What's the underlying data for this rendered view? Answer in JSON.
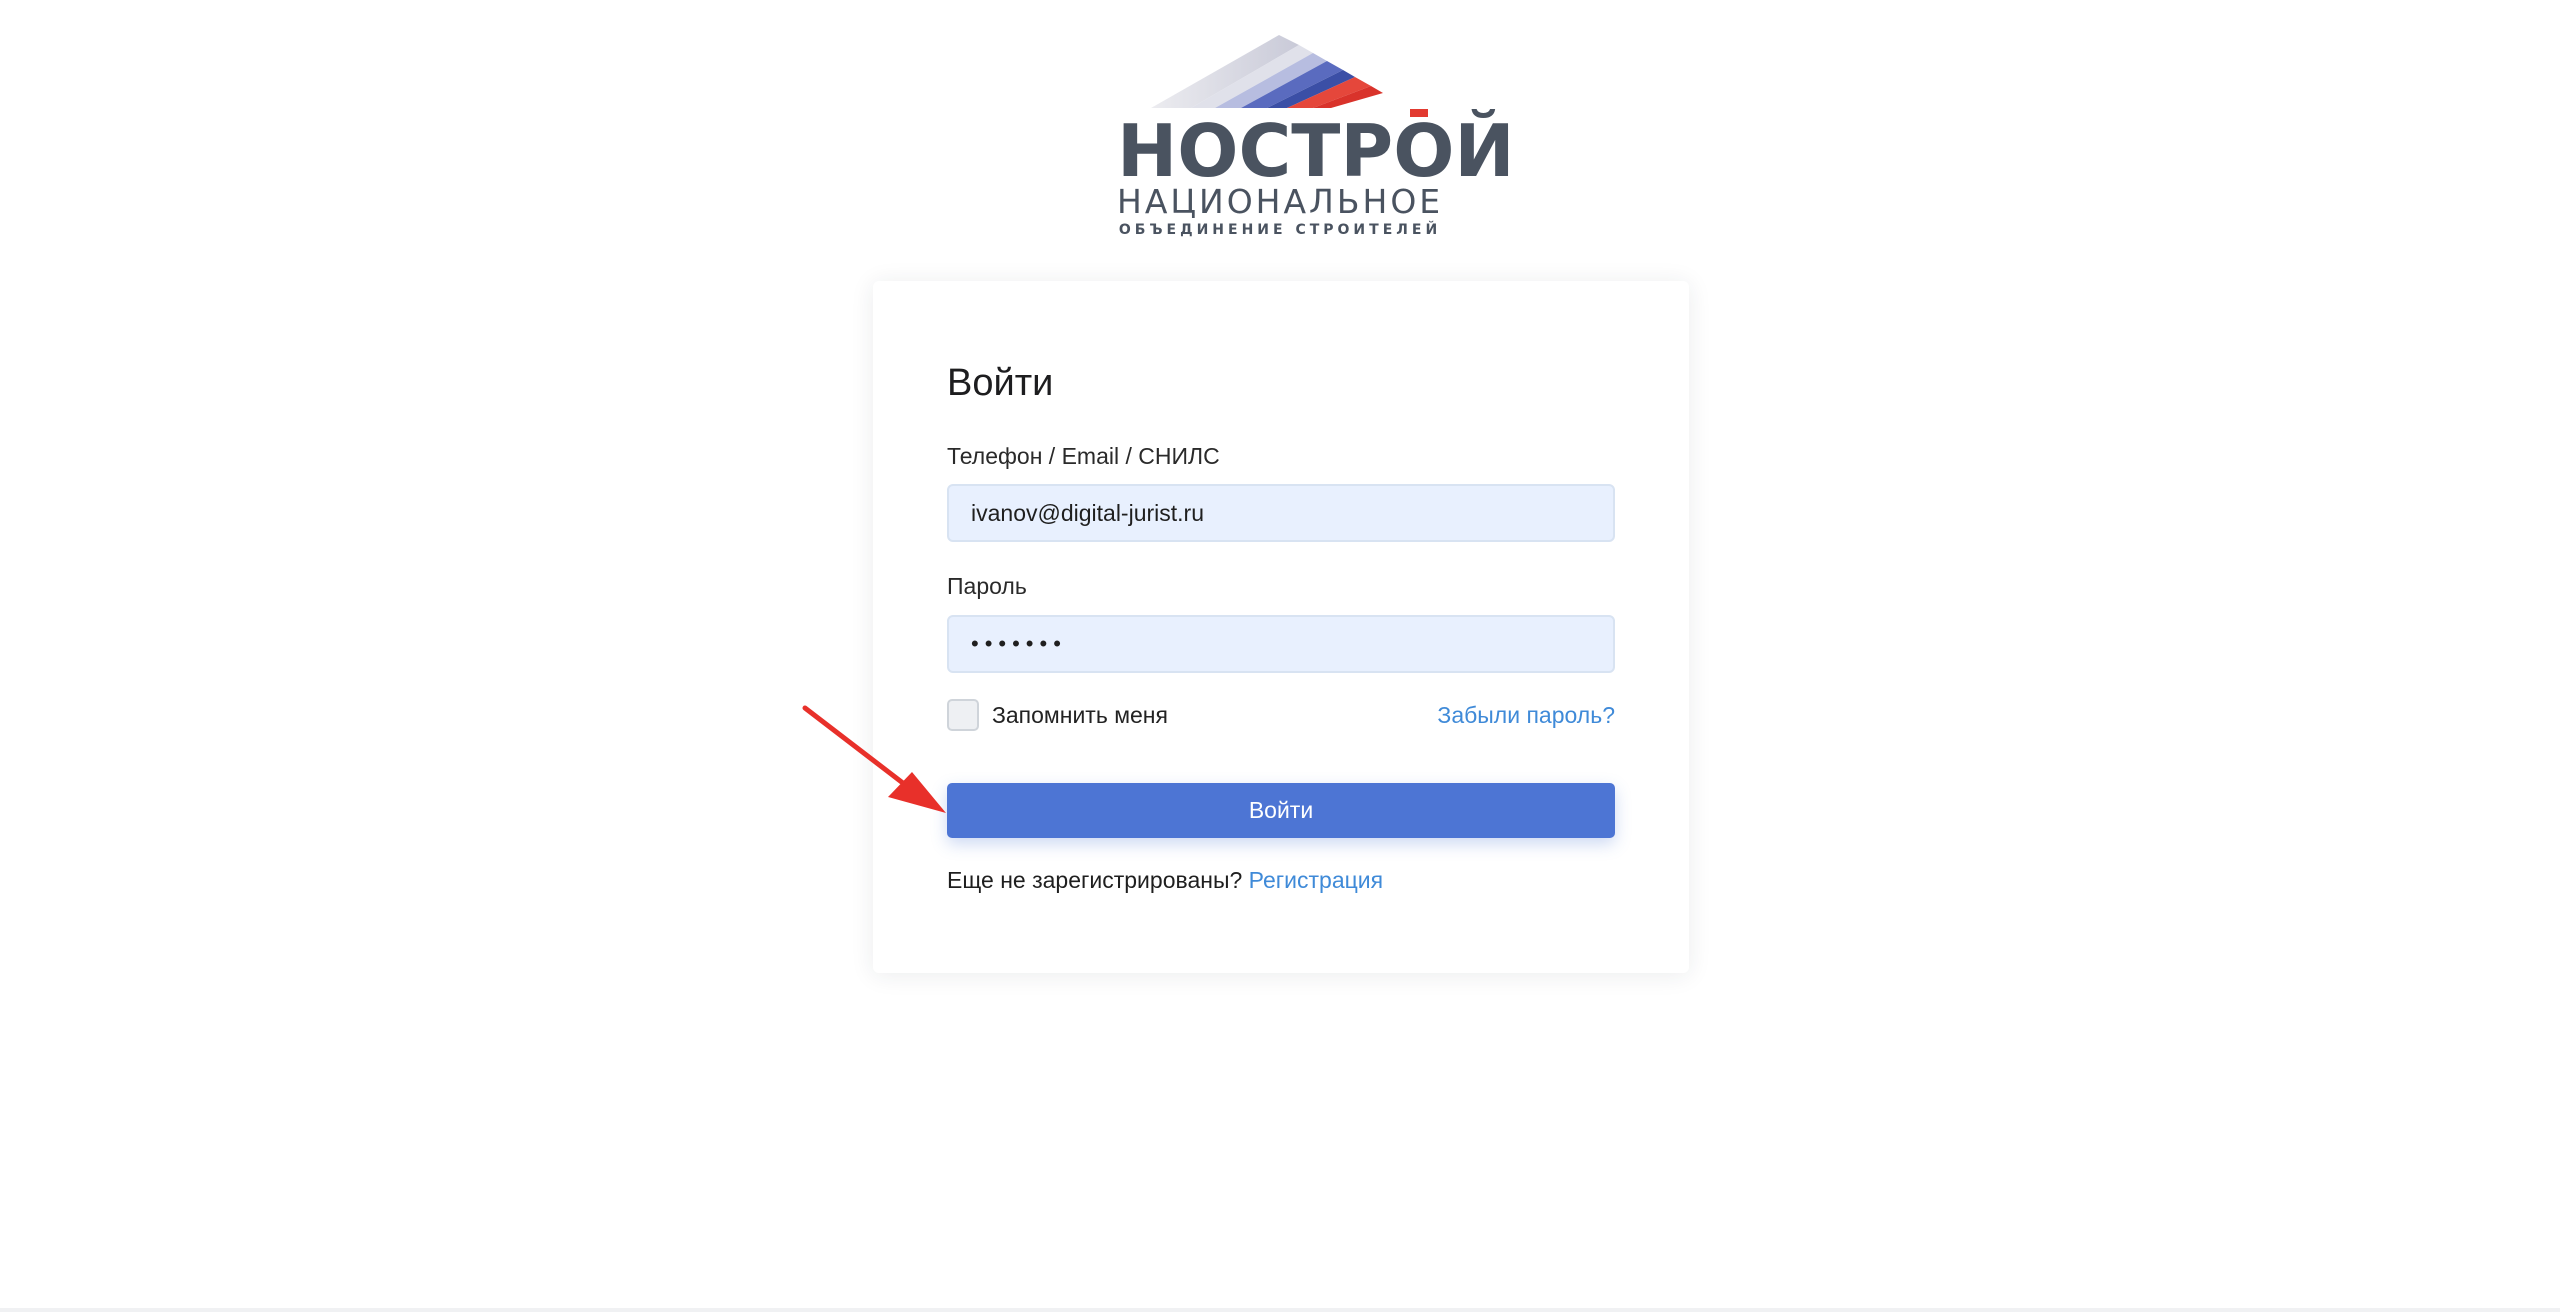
{
  "logo": {
    "wordmark": "НОСТРОЙ",
    "subtitle_line1": "НАЦИОНАЛЬНОЕ",
    "subtitle_line2": "ОБЪЕДИНЕНИЕ СТРОИТЕЛЕЙ",
    "colors": {
      "white": "#e2e2ea",
      "blue": "#4056a8",
      "red": "#e23a30",
      "text": "#4a5360"
    }
  },
  "login_form": {
    "title": "Войти",
    "login_label": "Телефон / Email / СНИЛС",
    "login_value": "ivanov@digital-jurist.ru",
    "password_label": "Пароль",
    "password_value": "•••••••",
    "remember_label": "Запомнить меня",
    "remember_checked": false,
    "forgot_link": "Забыли пароль?",
    "submit_label": "Войти",
    "register_prompt": "Еще не зарегистрированы?",
    "register_link": "Регистрация"
  },
  "annotation": {
    "arrow_color": "#e8302a",
    "arrow_icon": "red-arrow-pointing-to-submit"
  },
  "theme": {
    "primary": "#4d75d4",
    "link": "#3f8ad8",
    "input_bg": "#e8f0fe"
  }
}
